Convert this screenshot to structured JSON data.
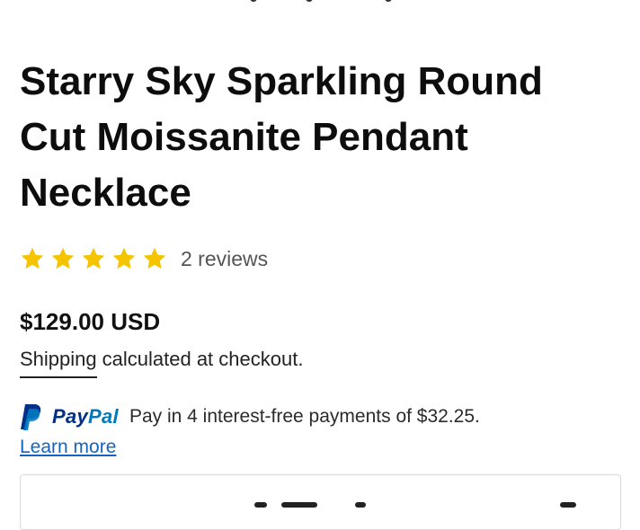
{
  "product": {
    "title": "Starry Sky Sparkling Round Cut Moissanite Pendant Necklace",
    "rating": 5,
    "rating_max": 5,
    "reviews_label": "2 reviews",
    "price": "$129.00 USD",
    "shipping_link": "Shipping",
    "shipping_text": "calculated at checkout."
  },
  "paypal": {
    "brand_pay": "Pay",
    "brand_pal": "Pal",
    "message": "Pay in 4 interest-free payments of $32.25.",
    "learn_more": "Learn more"
  },
  "colors": {
    "star": "#f5c400",
    "paypal_dark": "#003087",
    "paypal_light": "#0079c1",
    "link": "#1565c0"
  }
}
